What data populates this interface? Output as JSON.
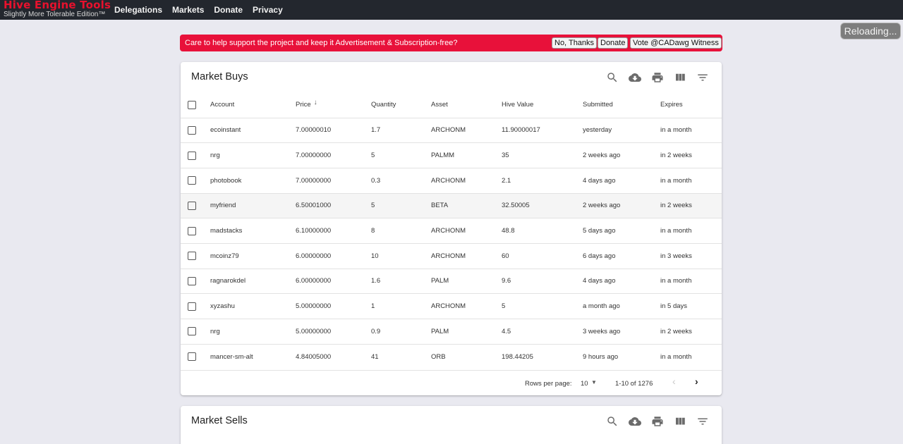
{
  "brand": {
    "title": "Hive Engine Tools",
    "subtitle": "Slightly More Tolerable Edition™"
  },
  "nav": [
    "Delegations",
    "Markets",
    "Donate",
    "Privacy"
  ],
  "status": {
    "reloading": "Reloading..."
  },
  "banner": {
    "text": "Care to help support the project and keep it Advertisement & Subscription-free?",
    "buttons": [
      "No, Thanks",
      "Donate",
      "Vote @CADawg Witness"
    ]
  },
  "buys": {
    "title": "Market Buys",
    "toolbar_icons": [
      "search-icon",
      "download-icon",
      "print-icon",
      "view-columns-icon",
      "filter-icon"
    ],
    "columns": [
      "Account",
      "Price",
      "Quantity",
      "Asset",
      "Hive Value",
      "Submitted",
      "Expires"
    ],
    "sort_icon": "↓",
    "rows": [
      [
        "ecoinstant",
        "7.00000010",
        "1.7",
        "ARCHONM",
        "11.90000017",
        "yesterday",
        "in a month"
      ],
      [
        "nrg",
        "7.00000000",
        "5",
        "PALMM",
        "35",
        "2 weeks ago",
        "in 2 weeks"
      ],
      [
        "photobook",
        "7.00000000",
        "0.3",
        "ARCHONM",
        "2.1",
        "4 days ago",
        "in a month"
      ],
      [
        "myfriend",
        "6.50001000",
        "5",
        "BETA",
        "32.50005",
        "2 weeks ago",
        "in 2 weeks"
      ],
      [
        "madstacks",
        "6.10000000",
        "8",
        "ARCHONM",
        "48.8",
        "5 days ago",
        "in a month"
      ],
      [
        "mcoinz79",
        "6.00000000",
        "10",
        "ARCHONM",
        "60",
        "6 days ago",
        "in 3 weeks"
      ],
      [
        "ragnarokdel",
        "6.00000000",
        "1.6",
        "PALM",
        "9.6",
        "4 days ago",
        "in a month"
      ],
      [
        "xyzashu",
        "5.00000000",
        "1",
        "ARCHONM",
        "5",
        "a month ago",
        "in 5 days"
      ],
      [
        "nrg",
        "5.00000000",
        "0.9",
        "PALM",
        "4.5",
        "3 weeks ago",
        "in 2 weeks"
      ],
      [
        "mancer-sm-alt",
        "4.84005000",
        "41",
        "ORB",
        "198.44205",
        "9 hours ago",
        "in a month"
      ]
    ],
    "highlight_row": 3,
    "footer": {
      "rows_per_page_label": "Rows per page:",
      "rows_per_page": "10",
      "range": "1-10 of 1276",
      "prev": "‹",
      "next": "›"
    }
  },
  "sells": {
    "title": "Market Sells",
    "toolbar_icons": [
      "search-icon",
      "download-icon",
      "print-icon",
      "view-columns-icon",
      "filter-icon"
    ]
  }
}
